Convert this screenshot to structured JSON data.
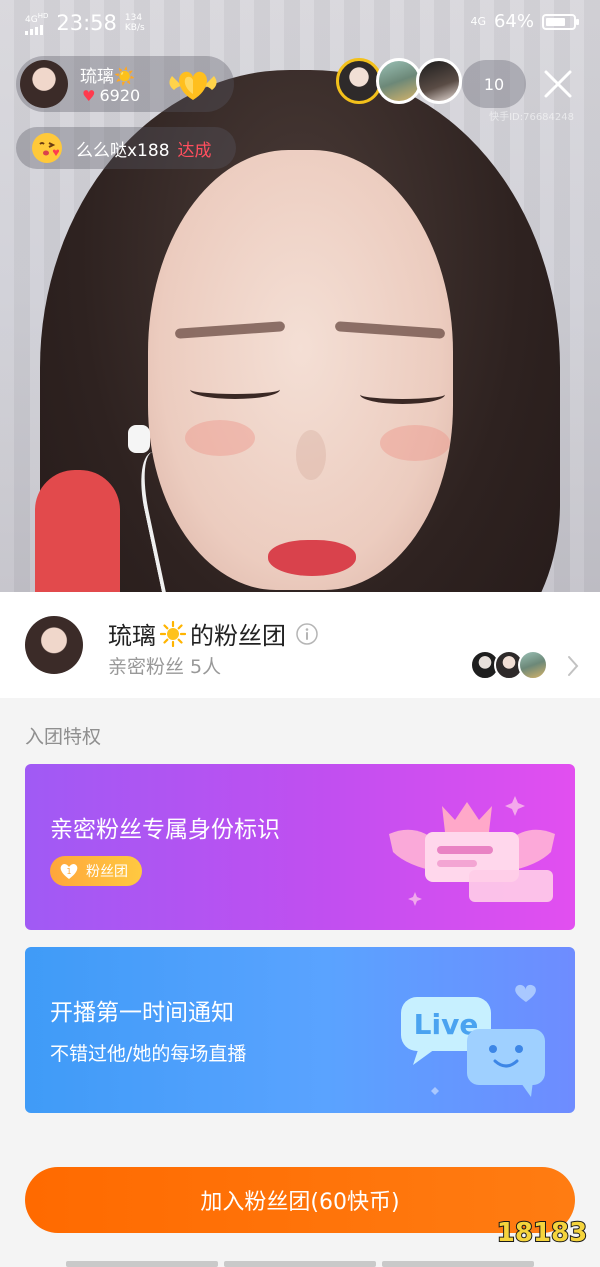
{
  "status_bar": {
    "network": "4G",
    "network_sup": "HD",
    "time": "23:58",
    "speed_value": "134",
    "speed_unit": "KB/s",
    "network_right": "4G",
    "battery": "64%"
  },
  "live": {
    "host_name": "琉璃☀️",
    "host_likes": "6920",
    "viewer_count": "10",
    "kuaishou_id": "快手ID:76684248",
    "gift_text": "么么哒x188",
    "gift_status": "达成"
  },
  "fan_club": {
    "title_name": "琉璃",
    "title_suffix": "的粉丝团",
    "subtitle": "亲密粉丝 5人"
  },
  "perks": {
    "section_label": "入团特权",
    "card1_title": "亲密粉丝专属身份标识",
    "card1_badge": "粉丝团",
    "card2_title": "开播第一时间通知",
    "card2_subtitle": "不错过他/她的每场直播",
    "live_word": "Live"
  },
  "join_button": "加入粉丝团(60快币)",
  "watermark": "18183",
  "colors": {
    "accent_orange": "#ff6a00",
    "purple_card": "#c14ff0",
    "blue_card": "#5aa3ff",
    "gift_done_red": "#ff4e5e"
  }
}
